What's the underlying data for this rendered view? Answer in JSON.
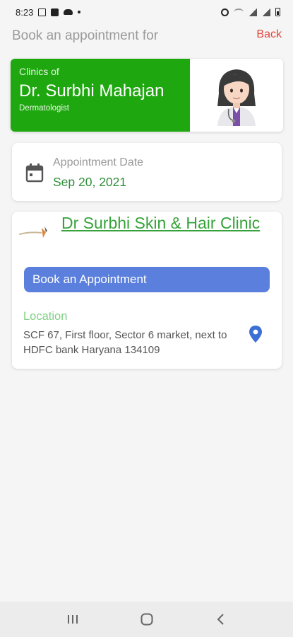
{
  "status_bar": {
    "time": "8:23"
  },
  "header": {
    "title": "Book an appointment for",
    "back_label": "Back"
  },
  "doctor": {
    "clinics_of": "Clinics of",
    "name": "Dr. Surbhi Mahajan",
    "specialty": "Dermatologist",
    "avatar_icon": "woman-doctor-emoji-icon",
    "accent_color": "#1ea70f"
  },
  "appointment": {
    "label": "Appointment Date",
    "date": "Sep 20, 2021"
  },
  "clinic": {
    "name": "Dr Surbhi Skin & Hair Clinic",
    "book_label": "Book an Appointment",
    "location_label": "Location",
    "address": "SCF 67, First floor, Sector 6 market, next to HDFC bank Haryana 134109",
    "button_color": "#5b7fdc"
  }
}
